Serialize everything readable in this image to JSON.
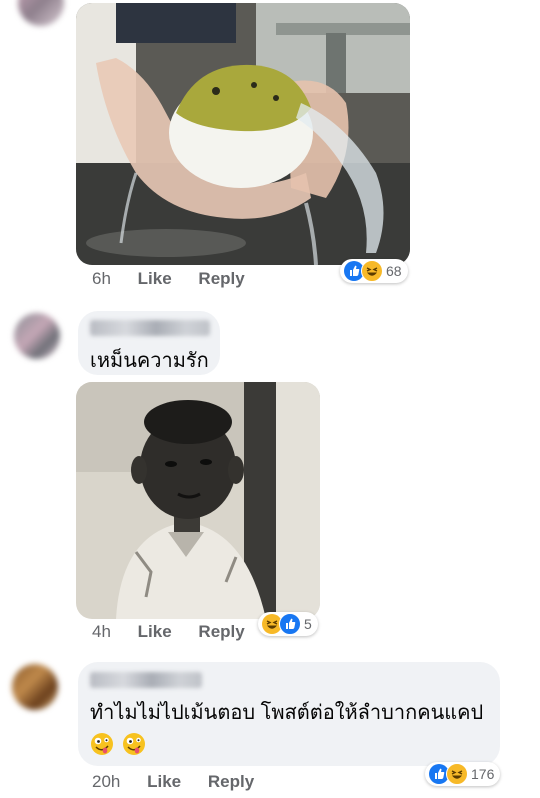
{
  "comments": [
    {
      "time": "6h",
      "like_label": "Like",
      "reply_label": "Reply",
      "reaction_count": "68",
      "reactions": [
        "like-icon",
        "haha-icon"
      ],
      "image_subject": "pufferfish"
    },
    {
      "text": "เหม็นความรัก",
      "time": "4h",
      "like_label": "Like",
      "reply_label": "Reply",
      "reaction_count": "5",
      "reactions": [
        "haha-icon",
        "like-icon"
      ],
      "image_subject": "child-photo"
    },
    {
      "text": "ทำไมไม่ไปเม้นตอบ โพสต์ต่อให้ลำบากคนแคป",
      "emojis": [
        "zany-face-icon",
        "zany-face-icon"
      ],
      "time": "20h",
      "like_label": "Like",
      "reply_label": "Reply",
      "reaction_count": "176",
      "reactions": [
        "like-icon",
        "haha-icon"
      ]
    }
  ],
  "colors": {
    "like_blue": "#1877f2",
    "haha_yellow": "#f7b928",
    "meta_gray": "#65676b",
    "bubble_bg": "#f0f2f5"
  }
}
